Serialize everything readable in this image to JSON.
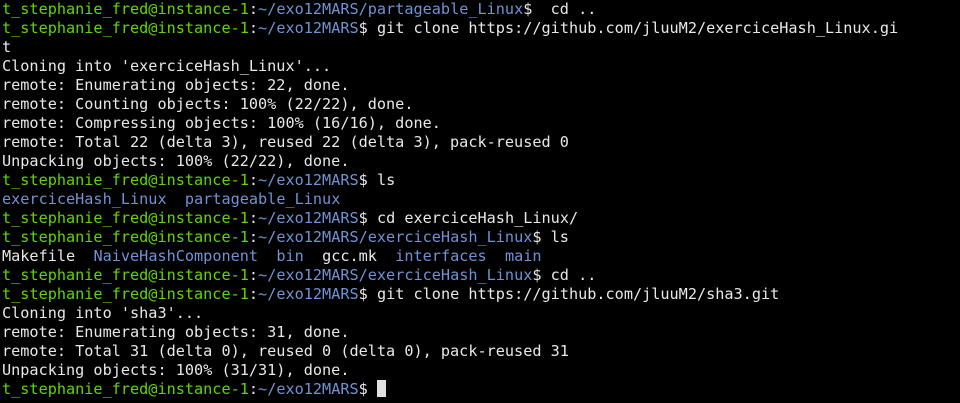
{
  "colors": {
    "background": "#000000",
    "user_host": "#5fd700",
    "path": "#6f93d6",
    "text": "#e8e8e8"
  },
  "prompt": {
    "user_host": "t_stephanie_fred@instance-1",
    "separator": ":",
    "dollar": "$"
  },
  "lines": [
    {
      "type": "prompt",
      "path": "~/exo12MARS/partageable_Linux",
      "cmd": "  cd .."
    },
    {
      "type": "prompt",
      "path": "~/exo12MARS",
      "cmd": " git clone https://github.com/jluuM2/exerciceHash_Linux.gi"
    },
    {
      "type": "output",
      "text": "t"
    },
    {
      "type": "output",
      "text": "Cloning into 'exerciceHash_Linux'..."
    },
    {
      "type": "output",
      "text": "remote: Enumerating objects: 22, done."
    },
    {
      "type": "output",
      "text": "remote: Counting objects: 100% (22/22), done."
    },
    {
      "type": "output",
      "text": "remote: Compressing objects: 100% (16/16), done."
    },
    {
      "type": "output",
      "text": "remote: Total 22 (delta 3), reused 22 (delta 3), pack-reused 0"
    },
    {
      "type": "output",
      "text": "Unpacking objects: 100% (22/22), done."
    },
    {
      "type": "prompt",
      "path": "~/exo12MARS",
      "cmd": " ls"
    },
    {
      "type": "ls",
      "items": [
        {
          "name": "exerciceHash_Linux",
          "kind": "dir"
        },
        {
          "name": "partageable_Linux",
          "kind": "dir"
        }
      ]
    },
    {
      "type": "prompt",
      "path": "~/exo12MARS",
      "cmd": " cd exerciceHash_Linux/"
    },
    {
      "type": "prompt",
      "path": "~/exo12MARS/exerciceHash_Linux",
      "cmd": " ls"
    },
    {
      "type": "ls",
      "items": [
        {
          "name": "Makefile",
          "kind": "file"
        },
        {
          "name": "NaiveHashComponent",
          "kind": "dir"
        },
        {
          "name": "bin",
          "kind": "dir"
        },
        {
          "name": "gcc.mk",
          "kind": "file"
        },
        {
          "name": "interfaces",
          "kind": "dir"
        },
        {
          "name": "main",
          "kind": "dir"
        }
      ]
    },
    {
      "type": "prompt",
      "path": "~/exo12MARS/exerciceHash_Linux",
      "cmd": " cd .."
    },
    {
      "type": "prompt",
      "path": "~/exo12MARS",
      "cmd": " git clone https://github.com/jluuM2/sha3.git"
    },
    {
      "type": "output",
      "text": "Cloning into 'sha3'..."
    },
    {
      "type": "output",
      "text": "remote: Enumerating objects: 31, done."
    },
    {
      "type": "output",
      "text": "remote: Total 31 (delta 0), reused 0 (delta 0), pack-reused 31"
    },
    {
      "type": "output",
      "text": "Unpacking objects: 100% (31/31), done."
    },
    {
      "type": "prompt",
      "path": "~/exo12MARS",
      "cmd": " ",
      "cursor": true
    }
  ]
}
